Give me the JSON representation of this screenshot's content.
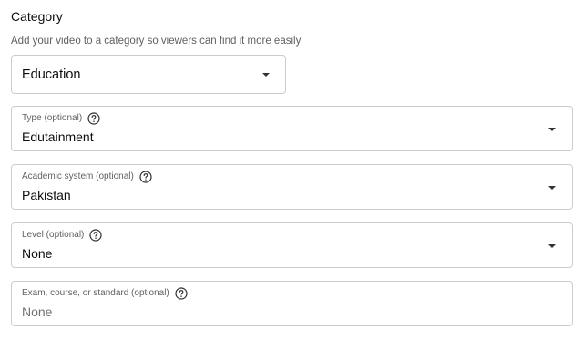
{
  "category_section": {
    "title": "Category",
    "subtitle": "Add your video to a category so viewers can find it more easily",
    "selected": "Education"
  },
  "fields": {
    "type": {
      "label": "Type (optional)",
      "value": "Edutainment"
    },
    "academic_system": {
      "label": "Academic system (optional)",
      "value": "Pakistan"
    },
    "level": {
      "label": "Level (optional)",
      "value": "None"
    },
    "exam": {
      "label": "Exam, course, or standard (optional)",
      "placeholder": "None"
    }
  },
  "icons": {
    "help": "help-circle-icon",
    "dropdown": "dropdown-caret-icon"
  },
  "colors": {
    "border": "#cccccc",
    "label": "#606060",
    "text": "#0d0d0d",
    "placeholder": "#717171"
  }
}
